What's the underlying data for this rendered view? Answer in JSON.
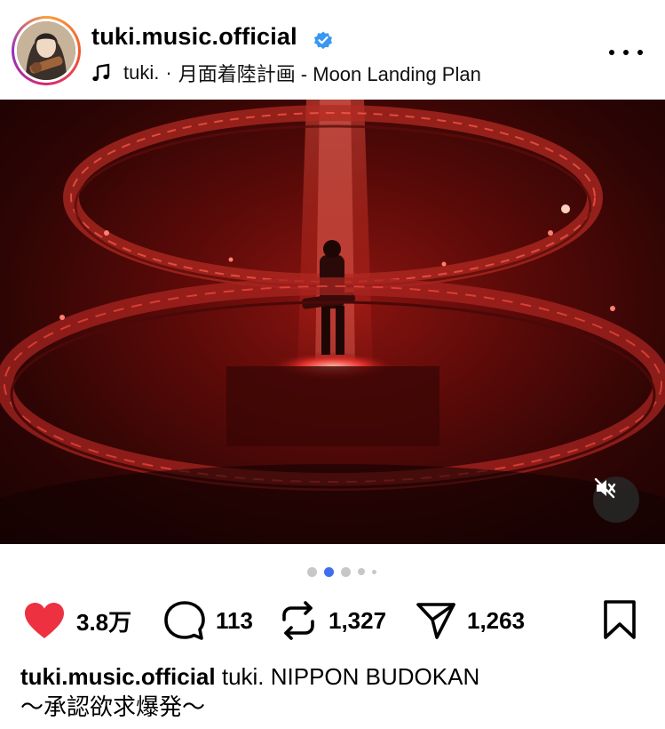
{
  "post": {
    "username": "tuki.music.official",
    "music_artist": "tuki.",
    "music_separator": "·",
    "music_title": "月面着陸計画 - Moon Landing Plan",
    "verified_icon": "verified-badge-icon",
    "more_icon": "more-options-icon"
  },
  "media": {
    "mute_icon": "sound-off-icon",
    "carousel": {
      "count": 5,
      "active_index": 1
    },
    "colors": {
      "stage_red": "#8a1410",
      "dark_red": "#1a0202"
    }
  },
  "actions": {
    "likes": "3.8万",
    "comments": "113",
    "reposts": "1,327",
    "shares": "1,263",
    "like_color": "#ed3140"
  },
  "caption": {
    "username": "tuki.music.official",
    "text_line1": "tuki.  NIPPON BUDOKAN",
    "text_line2": "〜承認欲求爆発〜"
  }
}
